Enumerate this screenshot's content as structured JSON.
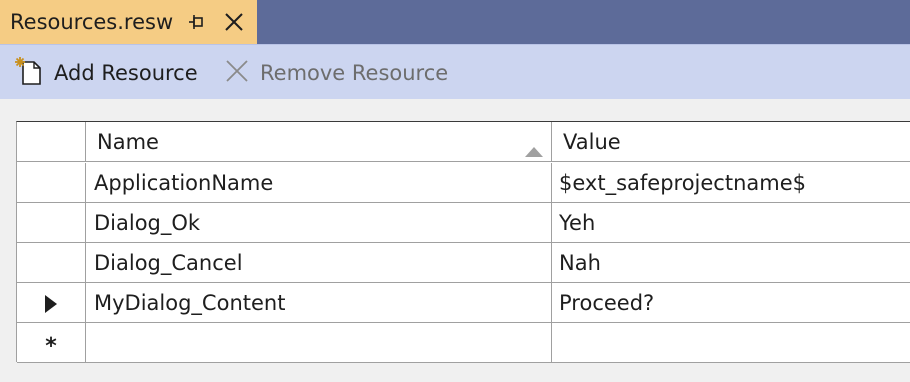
{
  "tab": {
    "title": "Resources.resw"
  },
  "toolbar": {
    "add_label": "Add Resource",
    "remove_label": "Remove Resource"
  },
  "grid": {
    "columns": {
      "name": "Name",
      "value": "Value"
    },
    "sort": {
      "column": "Name",
      "direction": "ascending"
    },
    "rows": [
      {
        "name": "ApplicationName",
        "value": "$ext_safeprojectname$"
      },
      {
        "name": "Dialog_Ok",
        "value": "Yeh"
      },
      {
        "name": "Dialog_Cancel",
        "value": "Nah"
      },
      {
        "name": "MyDialog_Content",
        "value": "Proceed?"
      }
    ],
    "new_row_marker": "*",
    "current_row_index": 3
  },
  "colors": {
    "tab_active": "#f5cc84",
    "tabstrip": "#5d6b99",
    "toolbar": "#ccd5f0"
  },
  "icons": {
    "tab_pin": "pin-icon",
    "tab_close": "close-icon",
    "add": "add-resource-icon",
    "remove": "remove-icon"
  }
}
